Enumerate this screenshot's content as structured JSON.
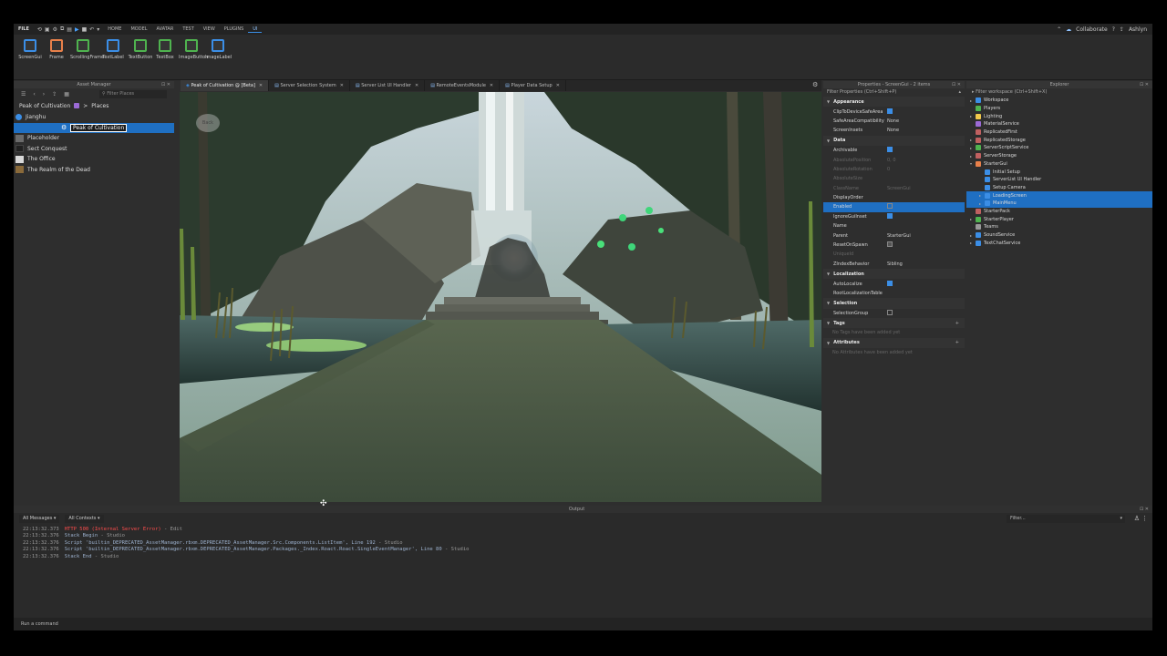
{
  "menubar": {
    "file": "FILE",
    "items": [
      "HOME",
      "MODEL",
      "AVATAR",
      "TEST",
      "VIEW",
      "PLUGINS",
      "UI"
    ],
    "active_index": 6,
    "collaborate": "Collaborate",
    "user": "Ashlyn"
  },
  "ribbon": {
    "tools": [
      {
        "label": "ScreenGui",
        "icon": "screengui-icon",
        "color": "#3b8ee6"
      },
      {
        "label": "Frame",
        "icon": "frame-icon",
        "color": "#e8804a"
      },
      {
        "label": "ScrollingFrame",
        "icon": "scrollingframe-icon",
        "color": "#4fb34f"
      },
      {
        "label": "TextLabel",
        "icon": "textlabel-icon",
        "color": "#3b8ee6"
      },
      {
        "label": "TextButton",
        "icon": "textbutton-icon",
        "color": "#4fb34f"
      },
      {
        "label": "TextBox",
        "icon": "textbox-icon",
        "color": "#4fb34f"
      },
      {
        "label": "ImageButton",
        "icon": "imagebutton-icon",
        "color": "#4fb34f"
      },
      {
        "label": "ImageLabel",
        "icon": "imagelabel-icon",
        "color": "#3b8ee6"
      }
    ]
  },
  "asset_manager": {
    "title": "Asset Manager",
    "filter_placeholder": "Filter Places",
    "breadcrumb": {
      "game": "Peak of Cultivation",
      "sep": ">",
      "folder": "Places"
    },
    "items": [
      {
        "label": "Jianghu",
        "type": "world"
      },
      {
        "label": "Peak of Cultivation",
        "type": "rename",
        "selected": true
      },
      {
        "label": "Placeholder",
        "type": "place"
      },
      {
        "label": "Sect Conquest",
        "type": "place"
      },
      {
        "label": "The Office",
        "type": "place"
      },
      {
        "label": "The Realm of the Dead",
        "type": "place"
      }
    ]
  },
  "tabs": [
    {
      "label": "Peak of Cultivation @ [Beta]",
      "active": true
    },
    {
      "label": "Server Selection System",
      "active": false
    },
    {
      "label": "Server List UI Handler",
      "active": false
    },
    {
      "label": "RemoteEventsModule",
      "active": false
    },
    {
      "label": "Player Data Setup",
      "active": false
    }
  ],
  "viewport": {
    "back_button": "Back"
  },
  "properties": {
    "title": "Properties - ScreenGui - 2 items",
    "filter_placeholder": "Filter Properties (Ctrl+Shift+P)",
    "rows": [
      {
        "kind": "section",
        "name": "Appearance"
      },
      {
        "kind": "prop",
        "name": "ClipToDeviceSafeArea",
        "value": "",
        "check": "on"
      },
      {
        "kind": "prop",
        "name": "SafeAreaCompatibility",
        "value": "None"
      },
      {
        "kind": "prop",
        "name": "ScreenInsets",
        "value": "None"
      },
      {
        "kind": "section",
        "name": "Data"
      },
      {
        "kind": "prop",
        "name": "Archivable",
        "value": "",
        "check": "on"
      },
      {
        "kind": "prop",
        "name": "AbsolutePosition",
        "value": "0, 0",
        "dim": true
      },
      {
        "kind": "prop",
        "name": "AbsoluteRotation",
        "value": "0",
        "dim": true
      },
      {
        "kind": "prop",
        "name": "AbsoluteSize",
        "value": "",
        "dim": true
      },
      {
        "kind": "prop",
        "name": "ClassName",
        "value": "ScreenGui",
        "dim": true
      },
      {
        "kind": "prop",
        "name": "DisplayOrder",
        "value": ""
      },
      {
        "kind": "prop",
        "name": "Enabled",
        "value": "",
        "check": "off",
        "selected": true
      },
      {
        "kind": "prop",
        "name": "IgnoreGuiInset",
        "value": "",
        "check": "on"
      },
      {
        "kind": "prop",
        "name": "Name",
        "value": ""
      },
      {
        "kind": "prop",
        "name": "Parent",
        "value": "StarterGui"
      },
      {
        "kind": "prop",
        "name": "ResetOnSpawn",
        "value": "",
        "check": "partial"
      },
      {
        "kind": "prop",
        "name": "Uniqueld",
        "value": "",
        "dim": true
      },
      {
        "kind": "prop",
        "name": "ZIndexBehavior",
        "value": "Sibling"
      },
      {
        "kind": "section",
        "name": "Localization"
      },
      {
        "kind": "prop",
        "name": "AutoLocalize",
        "value": "",
        "check": "on"
      },
      {
        "kind": "prop",
        "name": "RootLocalizationTable",
        "value": ""
      },
      {
        "kind": "section",
        "name": "Selection"
      },
      {
        "kind": "prop",
        "name": "SelectionGroup",
        "value": "",
        "check": "off"
      },
      {
        "kind": "section",
        "name": "Tags",
        "plus": true
      },
      {
        "kind": "note",
        "name": "No Tags have been added yet"
      },
      {
        "kind": "section",
        "name": "Attributes",
        "plus": true
      },
      {
        "kind": "note",
        "name": "No Attributes have been added yet"
      }
    ]
  },
  "explorer": {
    "title": "Explorer",
    "filter_placeholder": "Filter workspace (Ctrl+Shift+X)",
    "items": [
      {
        "label": "Workspace",
        "depth": 0,
        "arrow": "▸",
        "icon_color": "#3b8ee6"
      },
      {
        "label": "Players",
        "depth": 0,
        "arrow": "",
        "icon_color": "#4fb34f"
      },
      {
        "label": "Lighting",
        "depth": 0,
        "arrow": "▸",
        "icon_color": "#f2c94c"
      },
      {
        "label": "MaterialService",
        "depth": 0,
        "arrow": "",
        "icon_color": "#9b6ad6"
      },
      {
        "label": "ReplicatedFirst",
        "depth": 0,
        "arrow": "",
        "icon_color": "#c06060"
      },
      {
        "label": "ReplicatedStorage",
        "depth": 0,
        "arrow": "▸",
        "icon_color": "#c06060"
      },
      {
        "label": "ServerScriptService",
        "depth": 0,
        "arrow": "▸",
        "icon_color": "#4fb34f"
      },
      {
        "label": "ServerStorage",
        "depth": 0,
        "arrow": "▸",
        "icon_color": "#c06060"
      },
      {
        "label": "StarterGui",
        "depth": 0,
        "arrow": "▾",
        "icon_color": "#e8804a"
      },
      {
        "label": "Initial Setup",
        "depth": 1,
        "arrow": "",
        "icon_color": "#3b8ee6"
      },
      {
        "label": "ServerList UI Handler",
        "depth": 1,
        "arrow": "",
        "icon_color": "#3b8ee6"
      },
      {
        "label": "Setup Camera",
        "depth": 1,
        "arrow": "",
        "icon_color": "#3b8ee6"
      },
      {
        "label": "LoadingScreen",
        "depth": 1,
        "arrow": "▸",
        "icon_color": "#3b8ee6",
        "selected": true
      },
      {
        "label": "MainMenu",
        "depth": 1,
        "arrow": "▸",
        "icon_color": "#3b8ee6",
        "selected": true
      },
      {
        "label": "StarterPack",
        "depth": 0,
        "arrow": "",
        "icon_color": "#c06060"
      },
      {
        "label": "StarterPlayer",
        "depth": 0,
        "arrow": "▸",
        "icon_color": "#4fb34f"
      },
      {
        "label": "Teams",
        "depth": 0,
        "arrow": "",
        "icon_color": "#999999"
      },
      {
        "label": "SoundService",
        "depth": 0,
        "arrow": "▸",
        "icon_color": "#3b8ee6"
      },
      {
        "label": "TextChatService",
        "depth": 0,
        "arrow": "▸",
        "icon_color": "#3b8ee6"
      }
    ]
  },
  "output": {
    "title": "Output",
    "filter_messages": "All Messages",
    "filter_contexts": "All Contexts",
    "filter_placeholder": "Filter...",
    "lines": [
      {
        "time": "22:13:32.373",
        "msg": "HTTP 500 (Internal Server Error)",
        "src": "  -  Edit",
        "error": true
      },
      {
        "time": "22:13:32.376",
        "msg": "Stack Begin",
        "src": "  -  Studio",
        "error": false
      },
      {
        "time": "22:13:32.376",
        "msg": "Script 'builtin_DEPRECATED_AssetManager.rbxm.DEPRECATED_AssetManager.Src.Components.ListItem', Line 192",
        "src": "  -  Studio",
        "error": false
      },
      {
        "time": "22:13:32.376",
        "msg": "Script 'builtin_DEPRECATED_AssetManager.rbxm.DEPRECATED_AssetManager.Packages._Index.Roact.Roact.SingleEventManager', Line 80",
        "src": "  -  Studio",
        "error": false
      },
      {
        "time": "22:13:32.376",
        "msg": "Stack End",
        "src": "  -  Studio",
        "error": false
      }
    ],
    "command_placeholder": "Run a command"
  }
}
